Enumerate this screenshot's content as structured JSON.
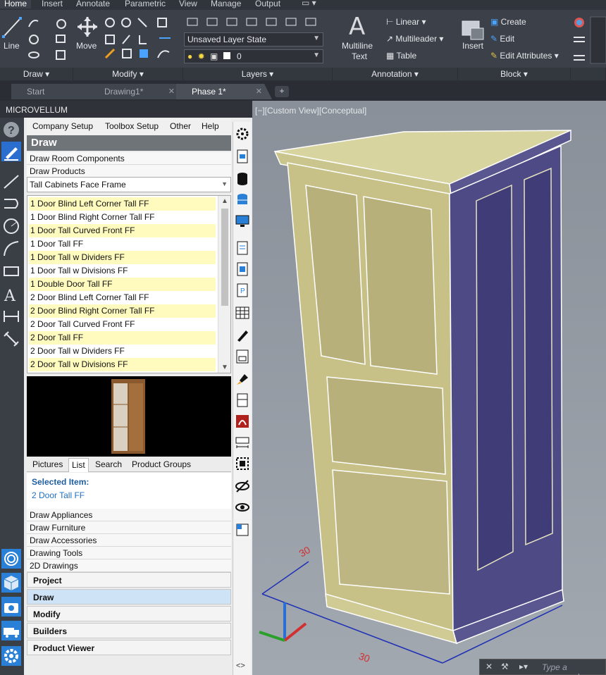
{
  "ribbon_tabs": [
    "Home",
    "Insert",
    "Annotate",
    "Parametric",
    "View",
    "Manage",
    "Output"
  ],
  "ribbon": {
    "draw": {
      "line_label": "Line",
      "panel_label": "Draw"
    },
    "modify": {
      "move_label": "Move",
      "panel_label": "Modify"
    },
    "layers": {
      "layer_state": "Unsaved Layer State",
      "current_layer": "0",
      "panel_label": "Layers"
    },
    "annotation": {
      "mtext_label_1": "Multiline",
      "mtext_label_2": "Text",
      "linear_label": "Linear",
      "multileader_label": "Multileader",
      "table_label": "Table",
      "panel_label": "Annotation"
    },
    "block": {
      "insert_label": "Insert",
      "create_label": "Create",
      "edit_label": "Edit",
      "edit_attributes_label": "Edit Attributes",
      "panel_label": "Block"
    }
  },
  "file_tabs": [
    {
      "label": "Start"
    },
    {
      "label": "Drawing1*"
    },
    {
      "label": "Phase 1*"
    }
  ],
  "palette": {
    "title": "MICROVELLUM",
    "menu": [
      "Company Setup",
      "Toolbox Setup",
      "Other",
      "Help"
    ],
    "section_title": "Draw",
    "links_top": [
      "Draw Room Components",
      "Draw Products"
    ],
    "product_category": "Tall Cabinets Face Frame",
    "products": [
      "1 Door Blind Left Corner Tall FF",
      "1 Door Blind Right Corner Tall FF",
      "1 Door Tall Curved Front FF",
      "1 Door Tall FF",
      "1 Door Tall w Dividers FF",
      "1 Door Tall w Divisions FF",
      "1 Double Door Tall FF",
      "2 Door Blind Left Corner Tall FF",
      "2 Door Blind Right Corner Tall FF",
      "2 Door Tall Curved Front FF",
      "2 Door Tall FF",
      "2 Door Tall w Dividers FF",
      "2 Door Tall w Divisions FF"
    ],
    "preview_tabs": [
      "Pictures",
      "List",
      "Search",
      "Product Groups"
    ],
    "selected_label": "Selected Item:",
    "selected_value": "2 Door Tall FF",
    "links_bottom": [
      "Draw Appliances",
      "Draw Furniture",
      "Draw Accessories",
      "Drawing Tools",
      "2D Drawings"
    ],
    "sections": [
      "Project",
      "Draw",
      "Modify",
      "Builders",
      "Product Viewer"
    ]
  },
  "viewport": {
    "label": "[−][Custom View][Conceptual]",
    "dimension_text": "30"
  },
  "command_line": {
    "placeholder": "Type a command"
  }
}
